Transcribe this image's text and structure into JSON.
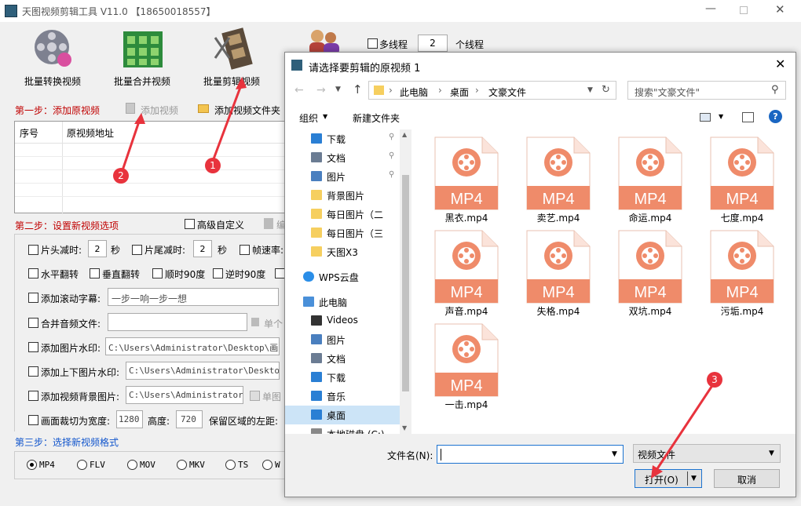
{
  "app": {
    "title": "天图视频剪辑工具 V11.0 【18650018557】",
    "multithread_label": "多线程",
    "thread_count": "2",
    "thread_unit": "个线程",
    "toolbar": [
      {
        "label": "批量转换视频",
        "icon": "film-reel-icon"
      },
      {
        "label": "批量合并视频",
        "icon": "merge-grid-icon"
      },
      {
        "label": "批量剪辑视频",
        "icon": "film-scissors-icon"
      }
    ],
    "step1": {
      "title": "第一步：添加原视频",
      "add_video": "添加视频",
      "add_folder": "添加视频文件夹",
      "col_index": "序号",
      "col_path": "原视频地址"
    },
    "step2": {
      "title": "第二步：设置新视频选项",
      "advanced": "高级自定义",
      "edit_partial": "编",
      "head_cut": "片头减时:",
      "head_val": "2",
      "sec1": "秒",
      "tail_cut": "片尾减时:",
      "tail_val": "2",
      "sec2": "秒",
      "fps": "帧速率:",
      "flip_h": "水平翻转",
      "flip_v": "垂直翻转",
      "rot_cw": "顺时90度",
      "rot_ccw": "逆时90度",
      "scroll_sub": "添加滚动字幕:",
      "scroll_sub_val": "一步一响一步一想",
      "merge_audio": "合并音频文件:",
      "single_partial": "单个",
      "img_watermark": "添加图片水印:",
      "img_watermark_val": "C:\\Users\\Administrator\\Desktop\\画中画",
      "tb_watermark": "添加上下图片水印:",
      "tb_watermark_val": "C:\\Users\\Administrator\\Desktop\\A",
      "bg_image": "添加视频背景图片:",
      "bg_image_val": "C:\\Users\\Administrator\\D",
      "single_image": "单图",
      "crop": "画面裁切为宽度:",
      "crop_w": "1280",
      "height_label": "高度:",
      "crop_h": "720",
      "keep_left": "保留区域的左距:"
    },
    "step3": {
      "title": "第三步：选择新视频格式",
      "formats": [
        "MP4",
        "FLV",
        "MOV",
        "MKV",
        "TS",
        "W"
      ],
      "selected": "MP4"
    },
    "annotations": [
      "1",
      "2",
      "3"
    ]
  },
  "dialog": {
    "title": "请选择要剪辑的原视频 1",
    "breadcrumb": [
      "此电脑",
      "桌面",
      "文豪文件"
    ],
    "search_placeholder": "搜索\"文豪文件\"",
    "organize": "组织",
    "new_folder": "新建文件夹",
    "nav": [
      {
        "label": "下载",
        "icon": "download-icon",
        "pinned": true
      },
      {
        "label": "文档",
        "icon": "document-icon",
        "pinned": true
      },
      {
        "label": "图片",
        "icon": "picture-icon",
        "pinned": true
      },
      {
        "label": "背景图片",
        "icon": "folder-icon",
        "pinned": false
      },
      {
        "label": "每日图片（二",
        "icon": "folder-icon",
        "pinned": false
      },
      {
        "label": "每日图片（三",
        "icon": "folder-icon",
        "pinned": false
      },
      {
        "label": "天图X3",
        "icon": "folder-icon",
        "pinned": false
      },
      {
        "label": "WPS云盘",
        "icon": "cloud-icon",
        "pinned": false
      },
      {
        "label": "此电脑",
        "icon": "computer-icon",
        "pinned": false
      },
      {
        "label": "Videos",
        "icon": "video-icon",
        "pinned": false
      },
      {
        "label": "图片",
        "icon": "picture-icon",
        "pinned": false
      },
      {
        "label": "文档",
        "icon": "document-icon",
        "pinned": false
      },
      {
        "label": "下载",
        "icon": "download-icon",
        "pinned": false
      },
      {
        "label": "音乐",
        "icon": "music-icon",
        "pinned": false
      },
      {
        "label": "桌面",
        "icon": "desktop-icon",
        "pinned": false
      },
      {
        "label": "本地磁盘 (C:)",
        "icon": "disk-icon",
        "pinned": false
      }
    ],
    "files": [
      "黑衣.mp4",
      "卖艺.mp4",
      "命运.mp4",
      "七度.mp4",
      "声音.mp4",
      "失格.mp4",
      "双坑.mp4",
      "污垢.mp4",
      "一击.mp4"
    ],
    "file_badge": "MP4",
    "filename_label": "文件名(N):",
    "filename_value": "",
    "filetype": "视频文件",
    "open": "打开(O)",
    "cancel": "取消"
  },
  "colors": {
    "red": "#c00000",
    "blue": "#1155cc",
    "mp4": "#ef8b6a",
    "annot": "#e8333d"
  }
}
